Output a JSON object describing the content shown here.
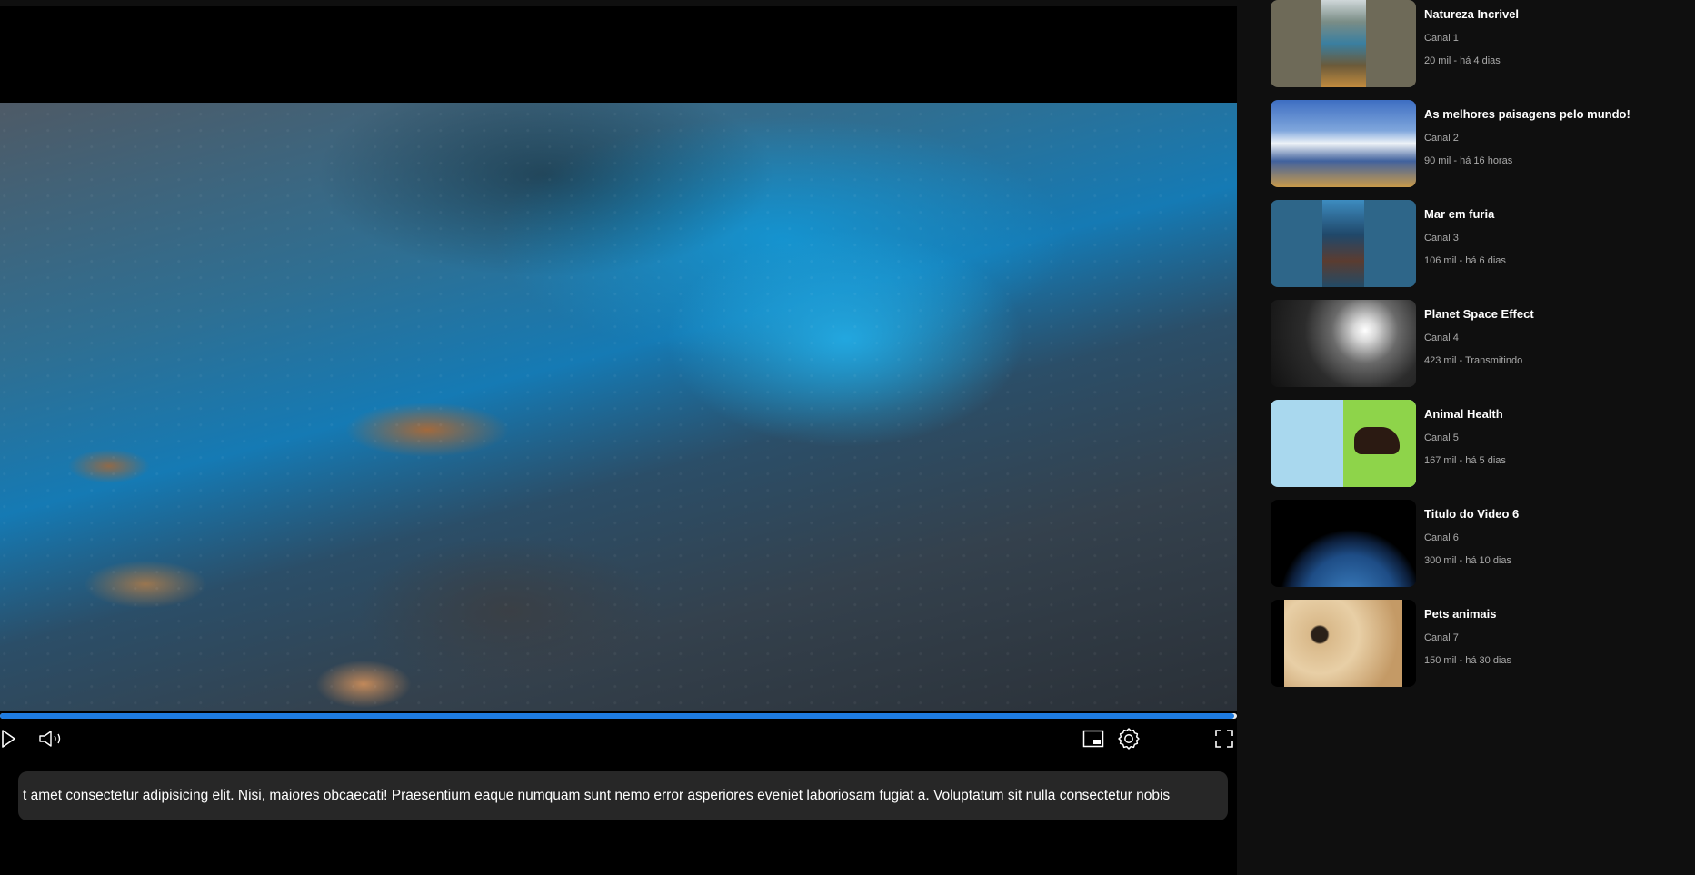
{
  "player": {
    "progress": 0.998,
    "description": "t amet consectetur adipisicing elit. Nisi, maiores obcaecati! Praesentium eaque numquam sunt nemo error asperiores eveniet laboriosam fugiat a. Voluptatum sit nulla consectetur nobis",
    "controls": {
      "play": "play-icon",
      "volume": "volume-icon",
      "miniplayer": "miniplayer-icon",
      "settings": "gear-icon",
      "fullscreen": "fullscreen-icon"
    },
    "colors": {
      "progress_fill": "#1e7be0",
      "progress_track": "#e9e9e9"
    }
  },
  "sidebar": {
    "videos": [
      {
        "title": "Natureza Incrivel",
        "channel": "Canal 1",
        "stats": "20 mil - há 4 dias"
      },
      {
        "title": "As melhores paisagens pelo mundo!",
        "channel": "Canal 2",
        "stats": "90 mil - há 16 horas"
      },
      {
        "title": "Mar em furia",
        "channel": "Canal 3",
        "stats": "106 mil - há 6 dias"
      },
      {
        "title": "Planet Space Effect",
        "channel": "Canal 4",
        "stats": "423 mil - Transmitindo"
      },
      {
        "title": "Animal Health",
        "channel": "Canal 5",
        "stats": "167 mil - há 5 dias"
      },
      {
        "title": "Titulo do Video 6",
        "channel": "Canal 6",
        "stats": "300 mil - há 10 dias"
      },
      {
        "title": "Pets animais",
        "channel": "Canal 7",
        "stats": "150 mil - há 30 dias"
      }
    ]
  }
}
